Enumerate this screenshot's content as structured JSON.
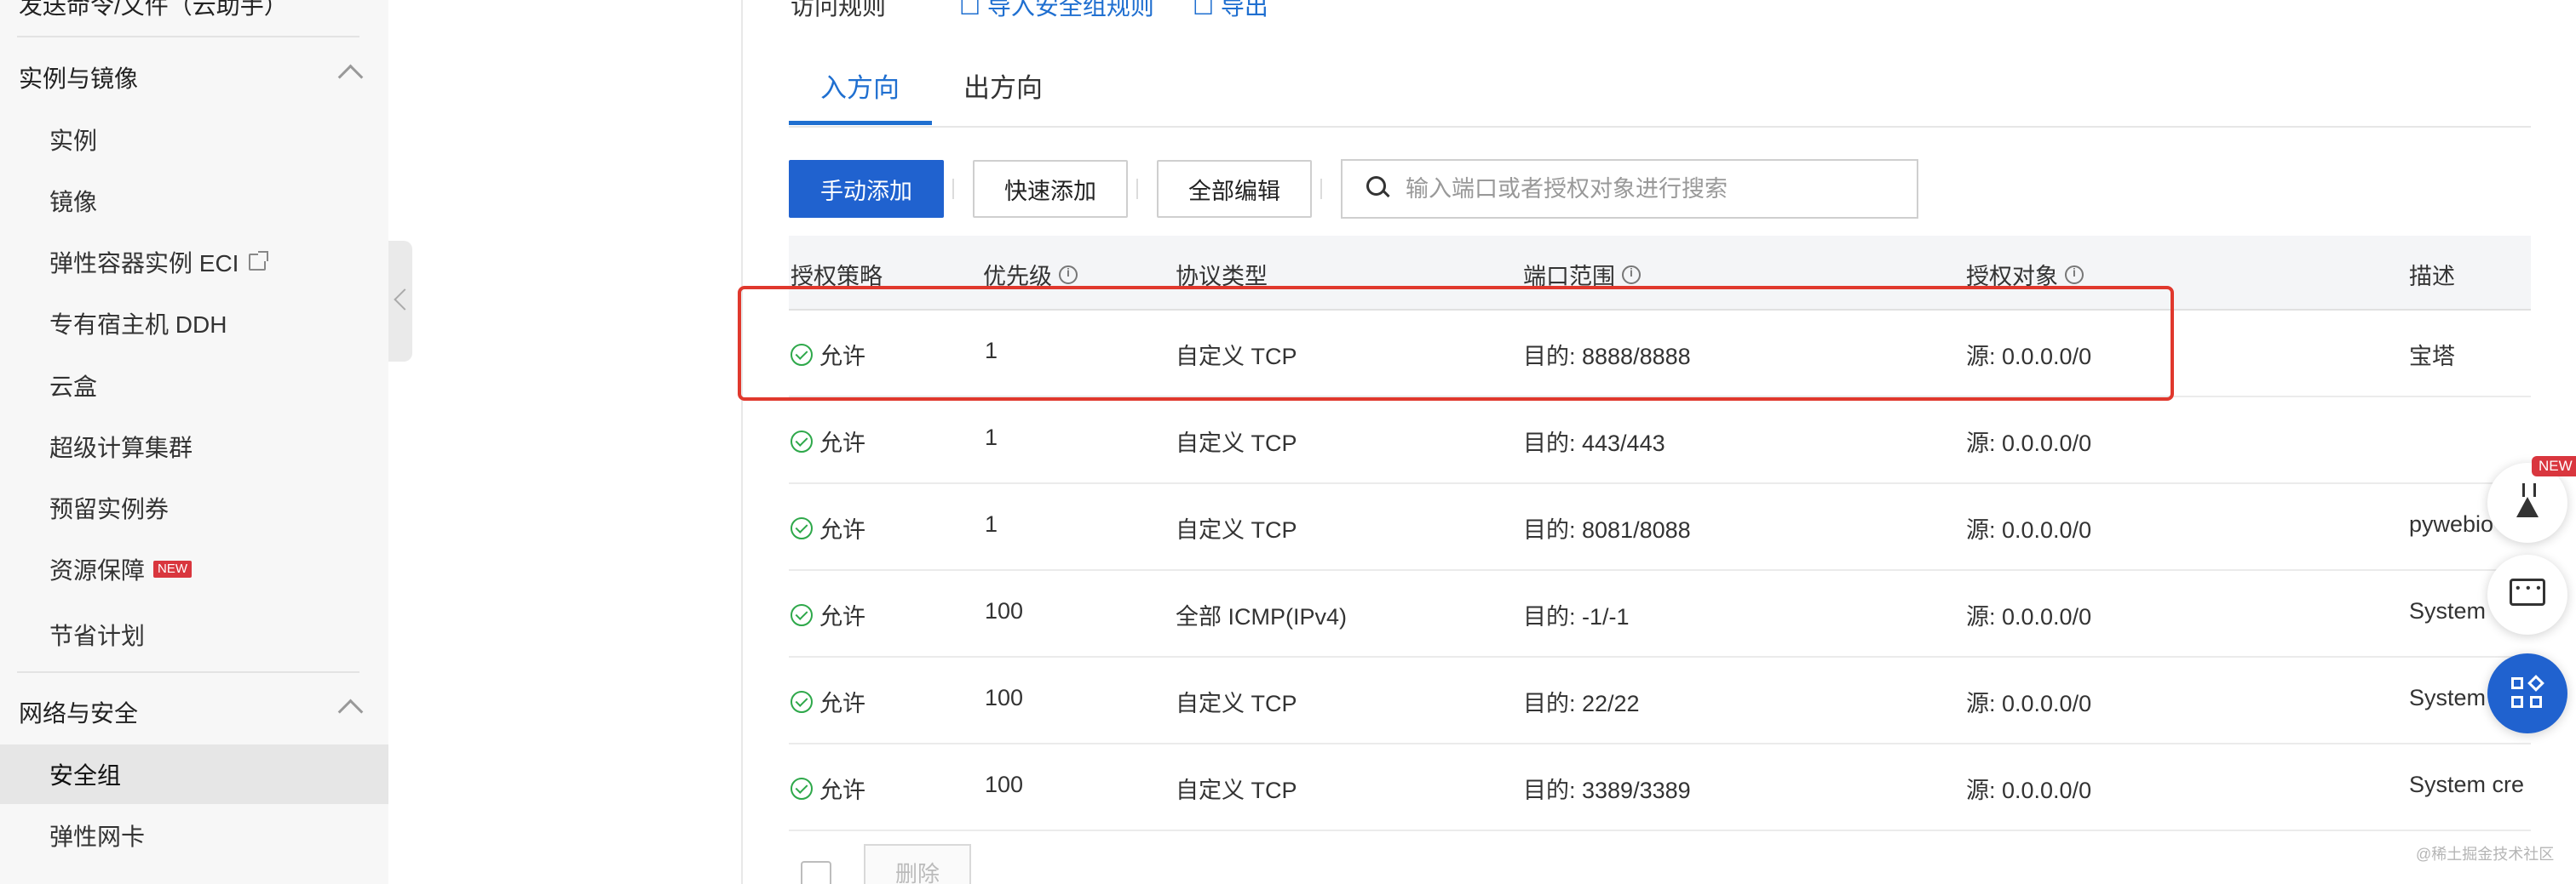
{
  "sidebar": {
    "top_cut_label": "发送命令/文件（云助手）",
    "groups": [
      {
        "title": "实例与镜像",
        "items": [
          {
            "label": "实例"
          },
          {
            "label": "镜像"
          },
          {
            "label": "弹性容器实例 ECI",
            "external": true
          },
          {
            "label": "专有宿主机 DDH"
          },
          {
            "label": "云盒"
          },
          {
            "label": "超级计算集群"
          },
          {
            "label": "预留实例券"
          },
          {
            "label": "资源保障",
            "badge": "NEW"
          },
          {
            "label": "节省计划"
          }
        ]
      },
      {
        "title": "网络与安全",
        "items": [
          {
            "label": "安全组",
            "active": true
          },
          {
            "label": "弹性网卡"
          }
        ]
      }
    ]
  },
  "header": {
    "cut_label": "访问规则",
    "import_link": "导入安全组规则",
    "export_link": "导出"
  },
  "tabs": [
    {
      "label": "入方向",
      "active": true
    },
    {
      "label": "出方向",
      "active": false
    }
  ],
  "toolbar": {
    "manual_add": "手动添加",
    "quick_add": "快速添加",
    "edit_all": "全部编辑",
    "search_placeholder": "输入端口或者授权对象进行搜索"
  },
  "table": {
    "columns": [
      "授权策略",
      "优先级",
      "协议类型",
      "端口范围",
      "授权对象",
      "描述"
    ],
    "rows": [
      {
        "policy": "允许",
        "priority": "1",
        "protocol": "自定义 TCP",
        "port": "目的: 8888/8888",
        "source": "源: 0.0.0.0/0",
        "desc": "宝塔"
      },
      {
        "policy": "允许",
        "priority": "1",
        "protocol": "自定义 TCP",
        "port": "目的: 443/443",
        "source": "源: 0.0.0.0/0",
        "desc": ""
      },
      {
        "policy": "允许",
        "priority": "1",
        "protocol": "自定义 TCP",
        "port": "目的: 8081/8088",
        "source": "源: 0.0.0.0/0",
        "desc": "pywebio"
      },
      {
        "policy": "允许",
        "priority": "100",
        "protocol": "全部 ICMP(IPv4)",
        "port": "目的: -1/-1",
        "source": "源: 0.0.0.0/0",
        "desc": "System"
      },
      {
        "policy": "允许",
        "priority": "100",
        "protocol": "自定义 TCP",
        "port": "目的: 22/22",
        "source": "源: 0.0.0.0/0",
        "desc": "System"
      },
      {
        "policy": "允许",
        "priority": "100",
        "protocol": "自定义 TCP",
        "port": "目的: 3389/3389",
        "source": "源: 0.0.0.0/0",
        "desc": "System cre"
      }
    ]
  },
  "footer": {
    "delete_label": "删除"
  },
  "floating": {
    "new_badge": "NEW"
  },
  "watermark": "@稀土掘金技术社区",
  "colors": {
    "accent": "#2062cf",
    "highlight": "#e0382d",
    "allow_green": "#2ea84a"
  }
}
